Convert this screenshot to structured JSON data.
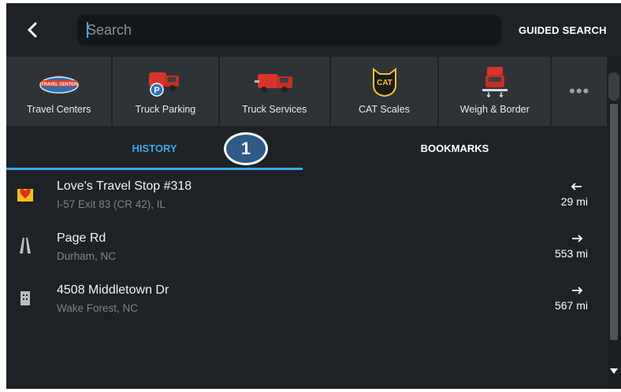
{
  "header": {
    "search_placeholder": "Search",
    "guided_search_label": "GUIDED SEARCH"
  },
  "categories": [
    {
      "label": "Travel Centers",
      "icon": "travel-center-icon",
      "badge": "TRAVEL CENTER"
    },
    {
      "label": "Truck Parking",
      "icon": "truck-parking-icon",
      "badge": "P"
    },
    {
      "label": "Truck Services",
      "icon": "truck-services-icon"
    },
    {
      "label": "CAT Scales",
      "icon": "cat-scales-icon",
      "badge": "CAT"
    },
    {
      "label": "Weigh & Border",
      "icon": "weigh-border-icon"
    }
  ],
  "more_label": "•••",
  "tabs": {
    "history": "HISTORY",
    "bookmarks": "BOOKMARKS"
  },
  "callout": "1",
  "history": [
    {
      "name": "Love's Travel Stop #318",
      "address": "I-57 Exit 83 (CR 42), IL",
      "distance": "29 mi",
      "direction": "west",
      "icon": "loves-logo-icon"
    },
    {
      "name": "Page Rd",
      "address": "Durham, NC",
      "distance": "553 mi",
      "direction": "east",
      "icon": "road-icon"
    },
    {
      "name": "4508 Middletown Dr",
      "address": "Wake Forest, NC",
      "distance": "567 mi",
      "direction": "east",
      "icon": "building-icon"
    }
  ],
  "colors": {
    "accent": "#3fa8e8",
    "background": "#1e2226",
    "callout": "#2d5a86"
  }
}
